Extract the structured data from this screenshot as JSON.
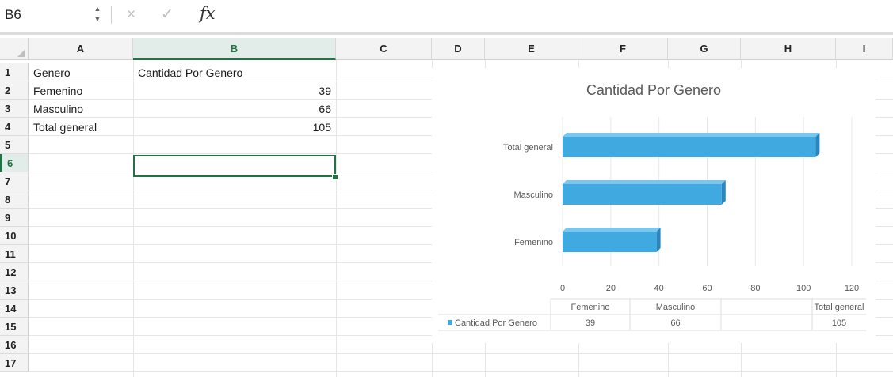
{
  "formula_bar": {
    "name_box": "B6",
    "cancel_icon": "×",
    "enter_icon": "✓",
    "fx_label": "fx"
  },
  "columns": [
    "A",
    "B",
    "C",
    "D",
    "E",
    "F",
    "G",
    "H",
    "I"
  ],
  "active_column": "B",
  "rows": [
    "1",
    "2",
    "3",
    "4",
    "5",
    "6",
    "7",
    "8",
    "9",
    "10",
    "11",
    "12",
    "13",
    "14",
    "15",
    "16",
    "17"
  ],
  "active_row": "6",
  "cells": {
    "A1": "Genero",
    "B1": "Cantidad Por Genero",
    "A2": "Femenino",
    "B2": "39",
    "A3": "Masculino",
    "B3": "66",
    "A4": "Total general",
    "B4": "105"
  },
  "selected_cell": "B6",
  "colors": {
    "accent": "#217346",
    "bar": "#3fa9e0",
    "bar_dark": "#2a86bd"
  },
  "chart_data": {
    "type": "bar",
    "orientation": "horizontal",
    "title": "Cantidad Por Genero",
    "categories": [
      "Femenino",
      "Masculino",
      "Total general"
    ],
    "series": [
      {
        "name": "Cantidad Por Genero",
        "values": [
          39,
          66,
          105
        ]
      }
    ],
    "x_ticks": [
      "0",
      "20",
      "40",
      "60",
      "80",
      "100",
      "120"
    ],
    "xlim": [
      0,
      120
    ],
    "grid": true,
    "legend": "data-table-bottom",
    "data_table": {
      "headers": [
        "Femenino",
        "Masculino",
        "Total general"
      ],
      "row_label": "Cantidad Por Genero",
      "values": [
        "39",
        "66",
        "105"
      ]
    }
  }
}
